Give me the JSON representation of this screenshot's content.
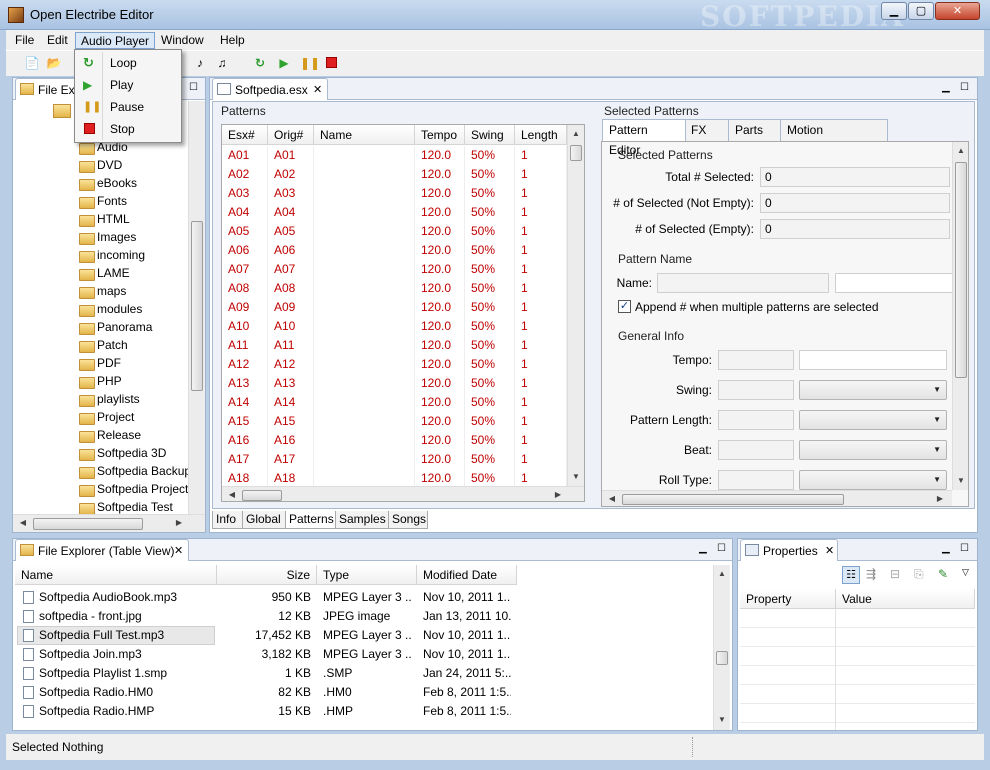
{
  "window": {
    "title": "Open Electribe Editor",
    "watermark": "SOFTPEDIA"
  },
  "menubar": [
    "File",
    "Edit",
    "Audio Player",
    "Window",
    "Help"
  ],
  "audio_menu": [
    "Loop",
    "Play",
    "Pause",
    "Stop"
  ],
  "file_explorer_tree": {
    "tab_label": "File Explorer",
    "tab_label_visible": "File Expl",
    "folders": [
      "Audio",
      "DVD",
      "eBooks",
      "Fonts",
      "HTML",
      "Images",
      "incoming",
      "LAME",
      "maps",
      "modules",
      "Panorama",
      "Patch",
      "PDF",
      "PHP",
      "playlists",
      "Project",
      "Release",
      "Softpedia 3D",
      "Softpedia Backup",
      "Softpedia Project",
      "Softpedia Test"
    ]
  },
  "editor": {
    "tab_label": "Softpedia.esx",
    "patterns_group": "Patterns",
    "columns": [
      "Esx#",
      "Orig#",
      "Name",
      "Tempo",
      "Swing",
      "Length"
    ],
    "rows": [
      [
        "A01",
        "A01",
        "",
        "120.0",
        "50%",
        "1"
      ],
      [
        "A02",
        "A02",
        "",
        "120.0",
        "50%",
        "1"
      ],
      [
        "A03",
        "A03",
        "",
        "120.0",
        "50%",
        "1"
      ],
      [
        "A04",
        "A04",
        "",
        "120.0",
        "50%",
        "1"
      ],
      [
        "A05",
        "A05",
        "",
        "120.0",
        "50%",
        "1"
      ],
      [
        "A06",
        "A06",
        "",
        "120.0",
        "50%",
        "1"
      ],
      [
        "A07",
        "A07",
        "",
        "120.0",
        "50%",
        "1"
      ],
      [
        "A08",
        "A08",
        "",
        "120.0",
        "50%",
        "1"
      ],
      [
        "A09",
        "A09",
        "",
        "120.0",
        "50%",
        "1"
      ],
      [
        "A10",
        "A10",
        "",
        "120.0",
        "50%",
        "1"
      ],
      [
        "A11",
        "A11",
        "",
        "120.0",
        "50%",
        "1"
      ],
      [
        "A12",
        "A12",
        "",
        "120.0",
        "50%",
        "1"
      ],
      [
        "A13",
        "A13",
        "",
        "120.0",
        "50%",
        "1"
      ],
      [
        "A14",
        "A14",
        "",
        "120.0",
        "50%",
        "1"
      ],
      [
        "A15",
        "A15",
        "",
        "120.0",
        "50%",
        "1"
      ],
      [
        "A16",
        "A16",
        "",
        "120.0",
        "50%",
        "1"
      ],
      [
        "A17",
        "A17",
        "",
        "120.0",
        "50%",
        "1"
      ],
      [
        "A18",
        "A18",
        "",
        "120.0",
        "50%",
        "1"
      ]
    ],
    "selected_patterns_group": "Selected Patterns",
    "sub_tabs": [
      "Pattern Editor",
      "FX",
      "Parts",
      "Motion Sequences"
    ],
    "form": {
      "selected_group": "Selected Patterns",
      "total_label": "Total # Selected:",
      "total_value": "0",
      "not_empty_label": "# of Selected (Not Empty):",
      "not_empty_value": "0",
      "empty_label": "# of Selected (Empty):",
      "empty_value": "0",
      "name_group": "Pattern Name",
      "name_label": "Name:",
      "append_label": "Append # when multiple patterns are selected",
      "general_group": "General Info",
      "tempo_label": "Tempo:",
      "swing_label": "Swing:",
      "length_label": "Pattern Length:",
      "beat_label": "Beat:",
      "roll_label": "Roll Type:"
    },
    "bottom_tabs": [
      "Info",
      "Global",
      "Patterns",
      "Samples",
      "Songs"
    ]
  },
  "file_table": {
    "tab_label": "File Explorer (Table View)",
    "columns": [
      "Name",
      "Size",
      "Type",
      "Modified Date"
    ],
    "rows": [
      [
        "Softpedia AudioBook.mp3",
        "950 KB",
        "MPEG Layer 3 ...",
        "Nov 10, 2011 1..."
      ],
      [
        "softpedia - front.jpg",
        "12 KB",
        "JPEG image",
        "Jan 13, 2011 10..."
      ],
      [
        "Softpedia Full Test.mp3",
        "17,452 KB",
        "MPEG Layer 3 ...",
        "Nov 10, 2011 1..."
      ],
      [
        "Softpedia Join.mp3",
        "3,182 KB",
        "MPEG Layer 3 ...",
        "Nov 10, 2011 1..."
      ],
      [
        "Softpedia Playlist 1.smp",
        "1 KB",
        ".SMP",
        "Jan 24, 2011 5:..."
      ],
      [
        "Softpedia Radio.HM0",
        "82 KB",
        ".HM0",
        "Feb 8, 2011 1:5..."
      ],
      [
        "Softpedia Radio.HMP",
        "15 KB",
        ".HMP",
        "Feb 8, 2011 1:5..."
      ]
    ]
  },
  "properties": {
    "tab_label": "Properties",
    "columns": [
      "Property",
      "Value"
    ]
  },
  "status": "Selected Nothing",
  "colors": {
    "pattern_text": "#c00000",
    "chrome": "#b9cde5"
  }
}
